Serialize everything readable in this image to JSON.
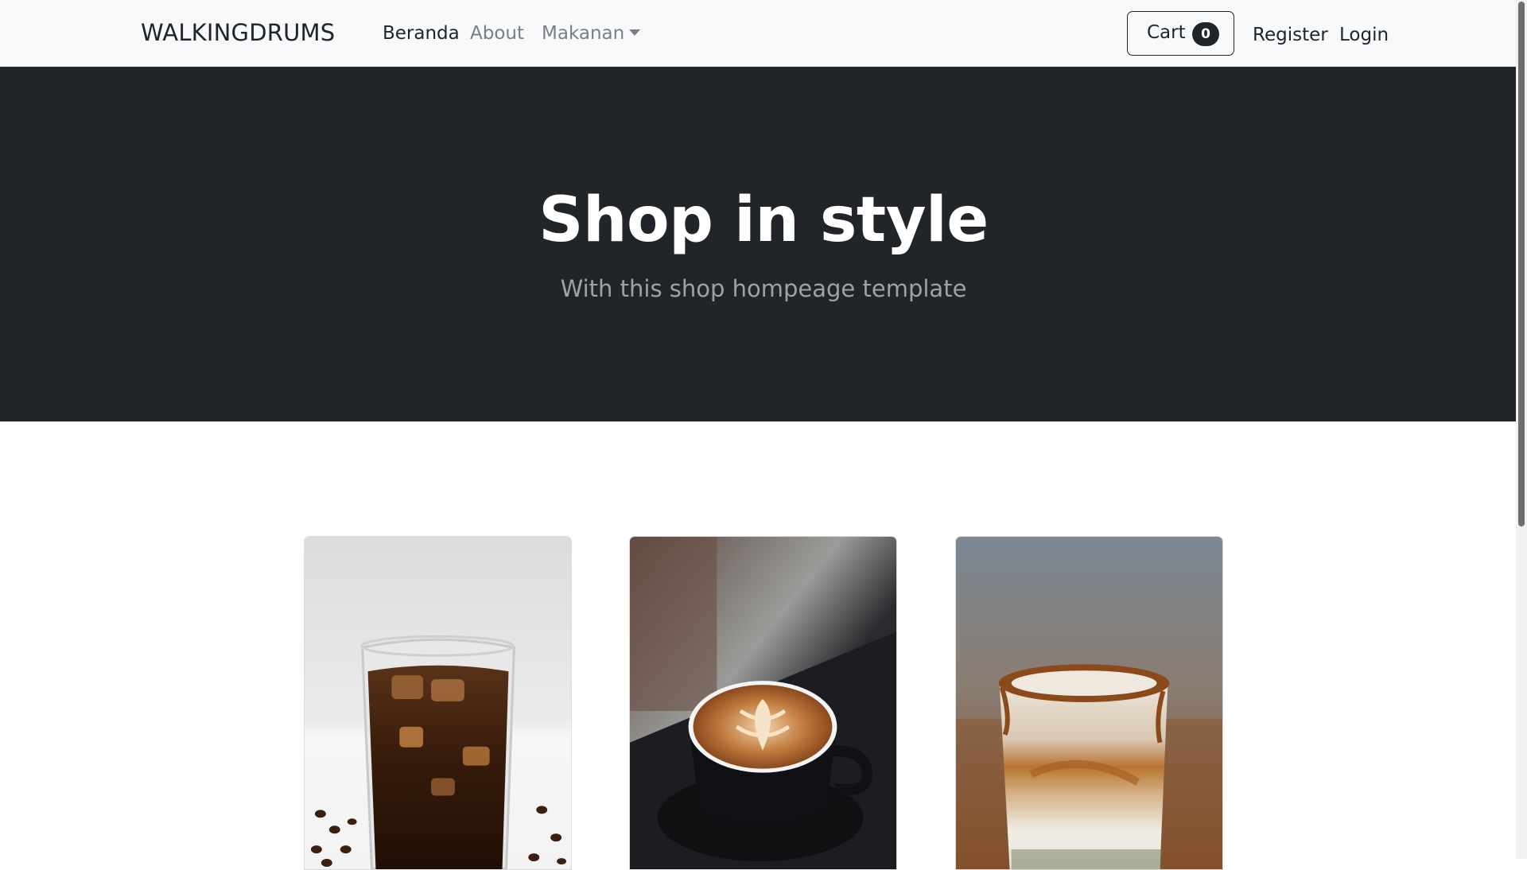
{
  "navbar": {
    "brand": "WALKINGDRUMS",
    "links": {
      "beranda": "Beranda",
      "about": "About",
      "makanan": "Makanan"
    },
    "cart": {
      "label": "Cart",
      "count": "0"
    },
    "register": "Register",
    "login": "Login"
  },
  "hero": {
    "title": "Shop in style",
    "subtitle": "With this shop hompeage template"
  },
  "products": [
    {
      "image": "iced-americano-glass-with-coffee-beans"
    },
    {
      "image": "latte-art-cup-on-saucer"
    },
    {
      "image": "layered-iced-latte-glass-with-sugar-rim"
    }
  ],
  "colors": {
    "navbar_bg": "#f8f9fa",
    "hero_bg": "#212529",
    "text_dark": "#212529",
    "text_muted": "#7b7f84",
    "hero_subtitle": "#9ea2a6"
  }
}
